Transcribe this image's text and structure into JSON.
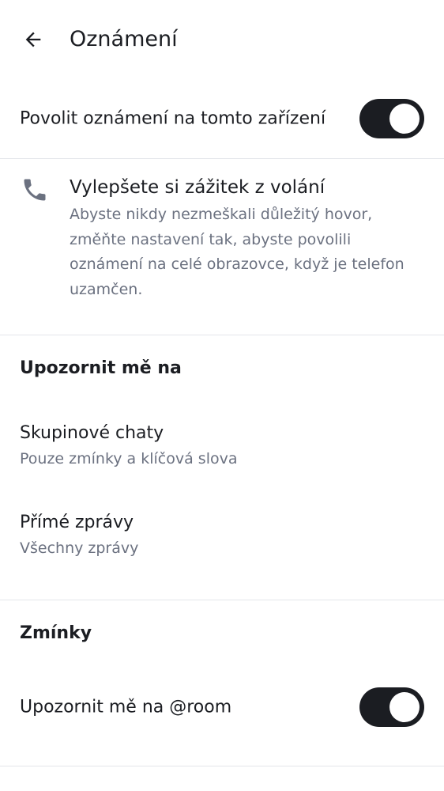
{
  "header": {
    "back_icon": "arrow-left-icon",
    "title": "Oznámení"
  },
  "enable_notifications": {
    "label": "Povolit oznámení na tomto zařízení",
    "enabled": true
  },
  "call_callout": {
    "icon": "phone-icon",
    "title": "Vylepšete si zážitek z volání",
    "body": "Abyste nikdy nezmeškali důležitý hovor, změňte nastavení tak, abyste povolili oznámení na celé obrazovce, když je telefon uzamčen."
  },
  "notify_section": {
    "header": "Upozornit mě na",
    "items": [
      {
        "title": "Skupinové chaty",
        "subtitle": "Pouze zmínky a klíčová slova"
      },
      {
        "title": "Přímé zprávy",
        "subtitle": "Všechny zprávy"
      }
    ]
  },
  "mentions_section": {
    "header": "Zmínky",
    "room_toggle": {
      "label": "Upozornit mě na @room",
      "enabled": true
    }
  },
  "colors": {
    "text_primary": "#1b1d22",
    "text_secondary": "#6b7180",
    "divider": "#e4e6ea",
    "switch_on": "#1b1d22"
  }
}
